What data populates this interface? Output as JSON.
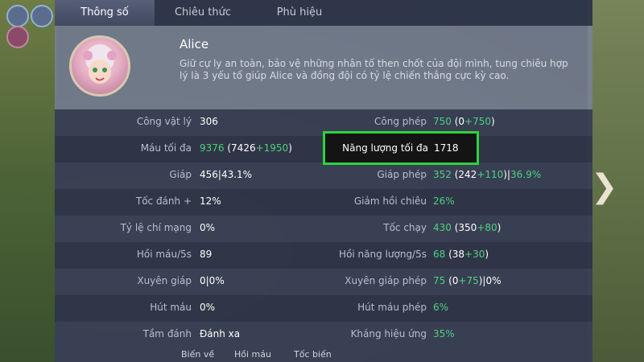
{
  "tabs": [
    {
      "label": "Thông số"
    },
    {
      "label": "Chiêu thức"
    },
    {
      "label": "Phù hiệu"
    }
  ],
  "hero": {
    "name": "Alice",
    "description": "Giữ cự ly an toàn, bảo vệ những nhân tố then chốt của đội mình, tung chiêu hợp lý là 3 yếu tố giúp Alice và đồng đội có tỷ lệ chiến thắng cực kỳ cao."
  },
  "stats_left": [
    {
      "label": "Công vật lý",
      "parts": [
        [
          "w",
          "306"
        ]
      ]
    },
    {
      "label": "Máu tối đa",
      "parts": [
        [
          "g",
          "9376"
        ],
        [
          "w",
          " (7426"
        ],
        [
          "g",
          "+1950"
        ],
        [
          "w",
          ")"
        ]
      ]
    },
    {
      "label": "Giáp",
      "parts": [
        [
          "w",
          "456|43.1%"
        ]
      ]
    },
    {
      "label": "Tốc đánh +",
      "parts": [
        [
          "w",
          "12%"
        ]
      ]
    },
    {
      "label": "Tỷ lệ chí mạng",
      "parts": [
        [
          "w",
          "0%"
        ]
      ]
    },
    {
      "label": "Hồi máu/5s",
      "parts": [
        [
          "w",
          "89"
        ]
      ]
    },
    {
      "label": "Xuyên giáp",
      "parts": [
        [
          "w",
          "0|0%"
        ]
      ]
    },
    {
      "label": "Hút máu",
      "parts": [
        [
          "w",
          "0%"
        ]
      ]
    },
    {
      "label": "Tầm đánh",
      "parts": [
        [
          "w",
          "Đánh xa"
        ]
      ]
    }
  ],
  "stats_right": [
    {
      "label": "Công phép",
      "parts": [
        [
          "g",
          "750"
        ],
        [
          "w",
          " (0"
        ],
        [
          "g",
          "+750"
        ],
        [
          "w",
          ")"
        ]
      ]
    },
    {
      "label": "Năng lượng tối đa",
      "parts": [
        [
          "w",
          "1718"
        ]
      ]
    },
    {
      "label": "Giáp phép",
      "parts": [
        [
          "g",
          "352"
        ],
        [
          "w",
          " (242"
        ],
        [
          "g",
          "+110"
        ],
        [
          "w",
          ")|"
        ],
        [
          "g",
          "36.9%"
        ]
      ]
    },
    {
      "label": "Giảm hồi chiêu",
      "parts": [
        [
          "g",
          "26%"
        ]
      ]
    },
    {
      "label": "Tốc chạy",
      "parts": [
        [
          "g",
          "430"
        ],
        [
          "w",
          " (350"
        ],
        [
          "g",
          "+80"
        ],
        [
          "w",
          ")"
        ]
      ]
    },
    {
      "label": "Hồi năng lượng/5s",
      "parts": [
        [
          "g",
          "68"
        ],
        [
          "w",
          " (38"
        ],
        [
          "g",
          "+30"
        ],
        [
          "w",
          ")"
        ]
      ]
    },
    {
      "label": "Xuyên giáp phép",
      "parts": [
        [
          "g",
          "75"
        ],
        [
          "w",
          " (0"
        ],
        [
          "g",
          "+75"
        ],
        [
          "w",
          ")|0%"
        ]
      ]
    },
    {
      "label": "Hút máu phép",
      "parts": [
        [
          "g",
          "6%"
        ]
      ]
    },
    {
      "label": "Kháng hiệu ứng",
      "parts": [
        [
          "g",
          "35%"
        ]
      ]
    }
  ],
  "bottom_labels": [
    "Biến về",
    "Hồi máu",
    "Tốc biến"
  ],
  "colors": {
    "green": "#4fd07f",
    "highlight_border": "#2ed23a"
  }
}
